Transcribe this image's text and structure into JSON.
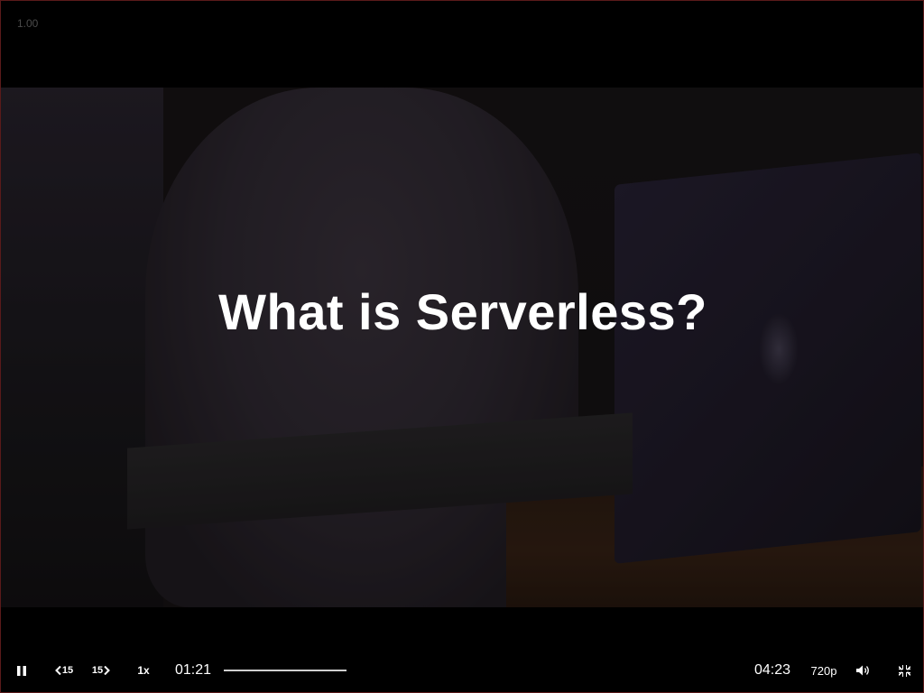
{
  "zoom_readout": "1.00",
  "slide": {
    "title": "What is Serverless?"
  },
  "controls": {
    "pause_icon": "pause-icon",
    "rewind": {
      "icon": "rewind-15-icon",
      "label": "15"
    },
    "forward": {
      "icon": "forward-15-icon",
      "label": "15"
    },
    "speed_label": "1x",
    "current_time": "01:21",
    "duration": "04:23",
    "progress_fraction": 0.238,
    "quality_label": "720p",
    "volume_icon": "volume-icon",
    "exit_fullscreen_icon": "exit-fullscreen-icon"
  }
}
